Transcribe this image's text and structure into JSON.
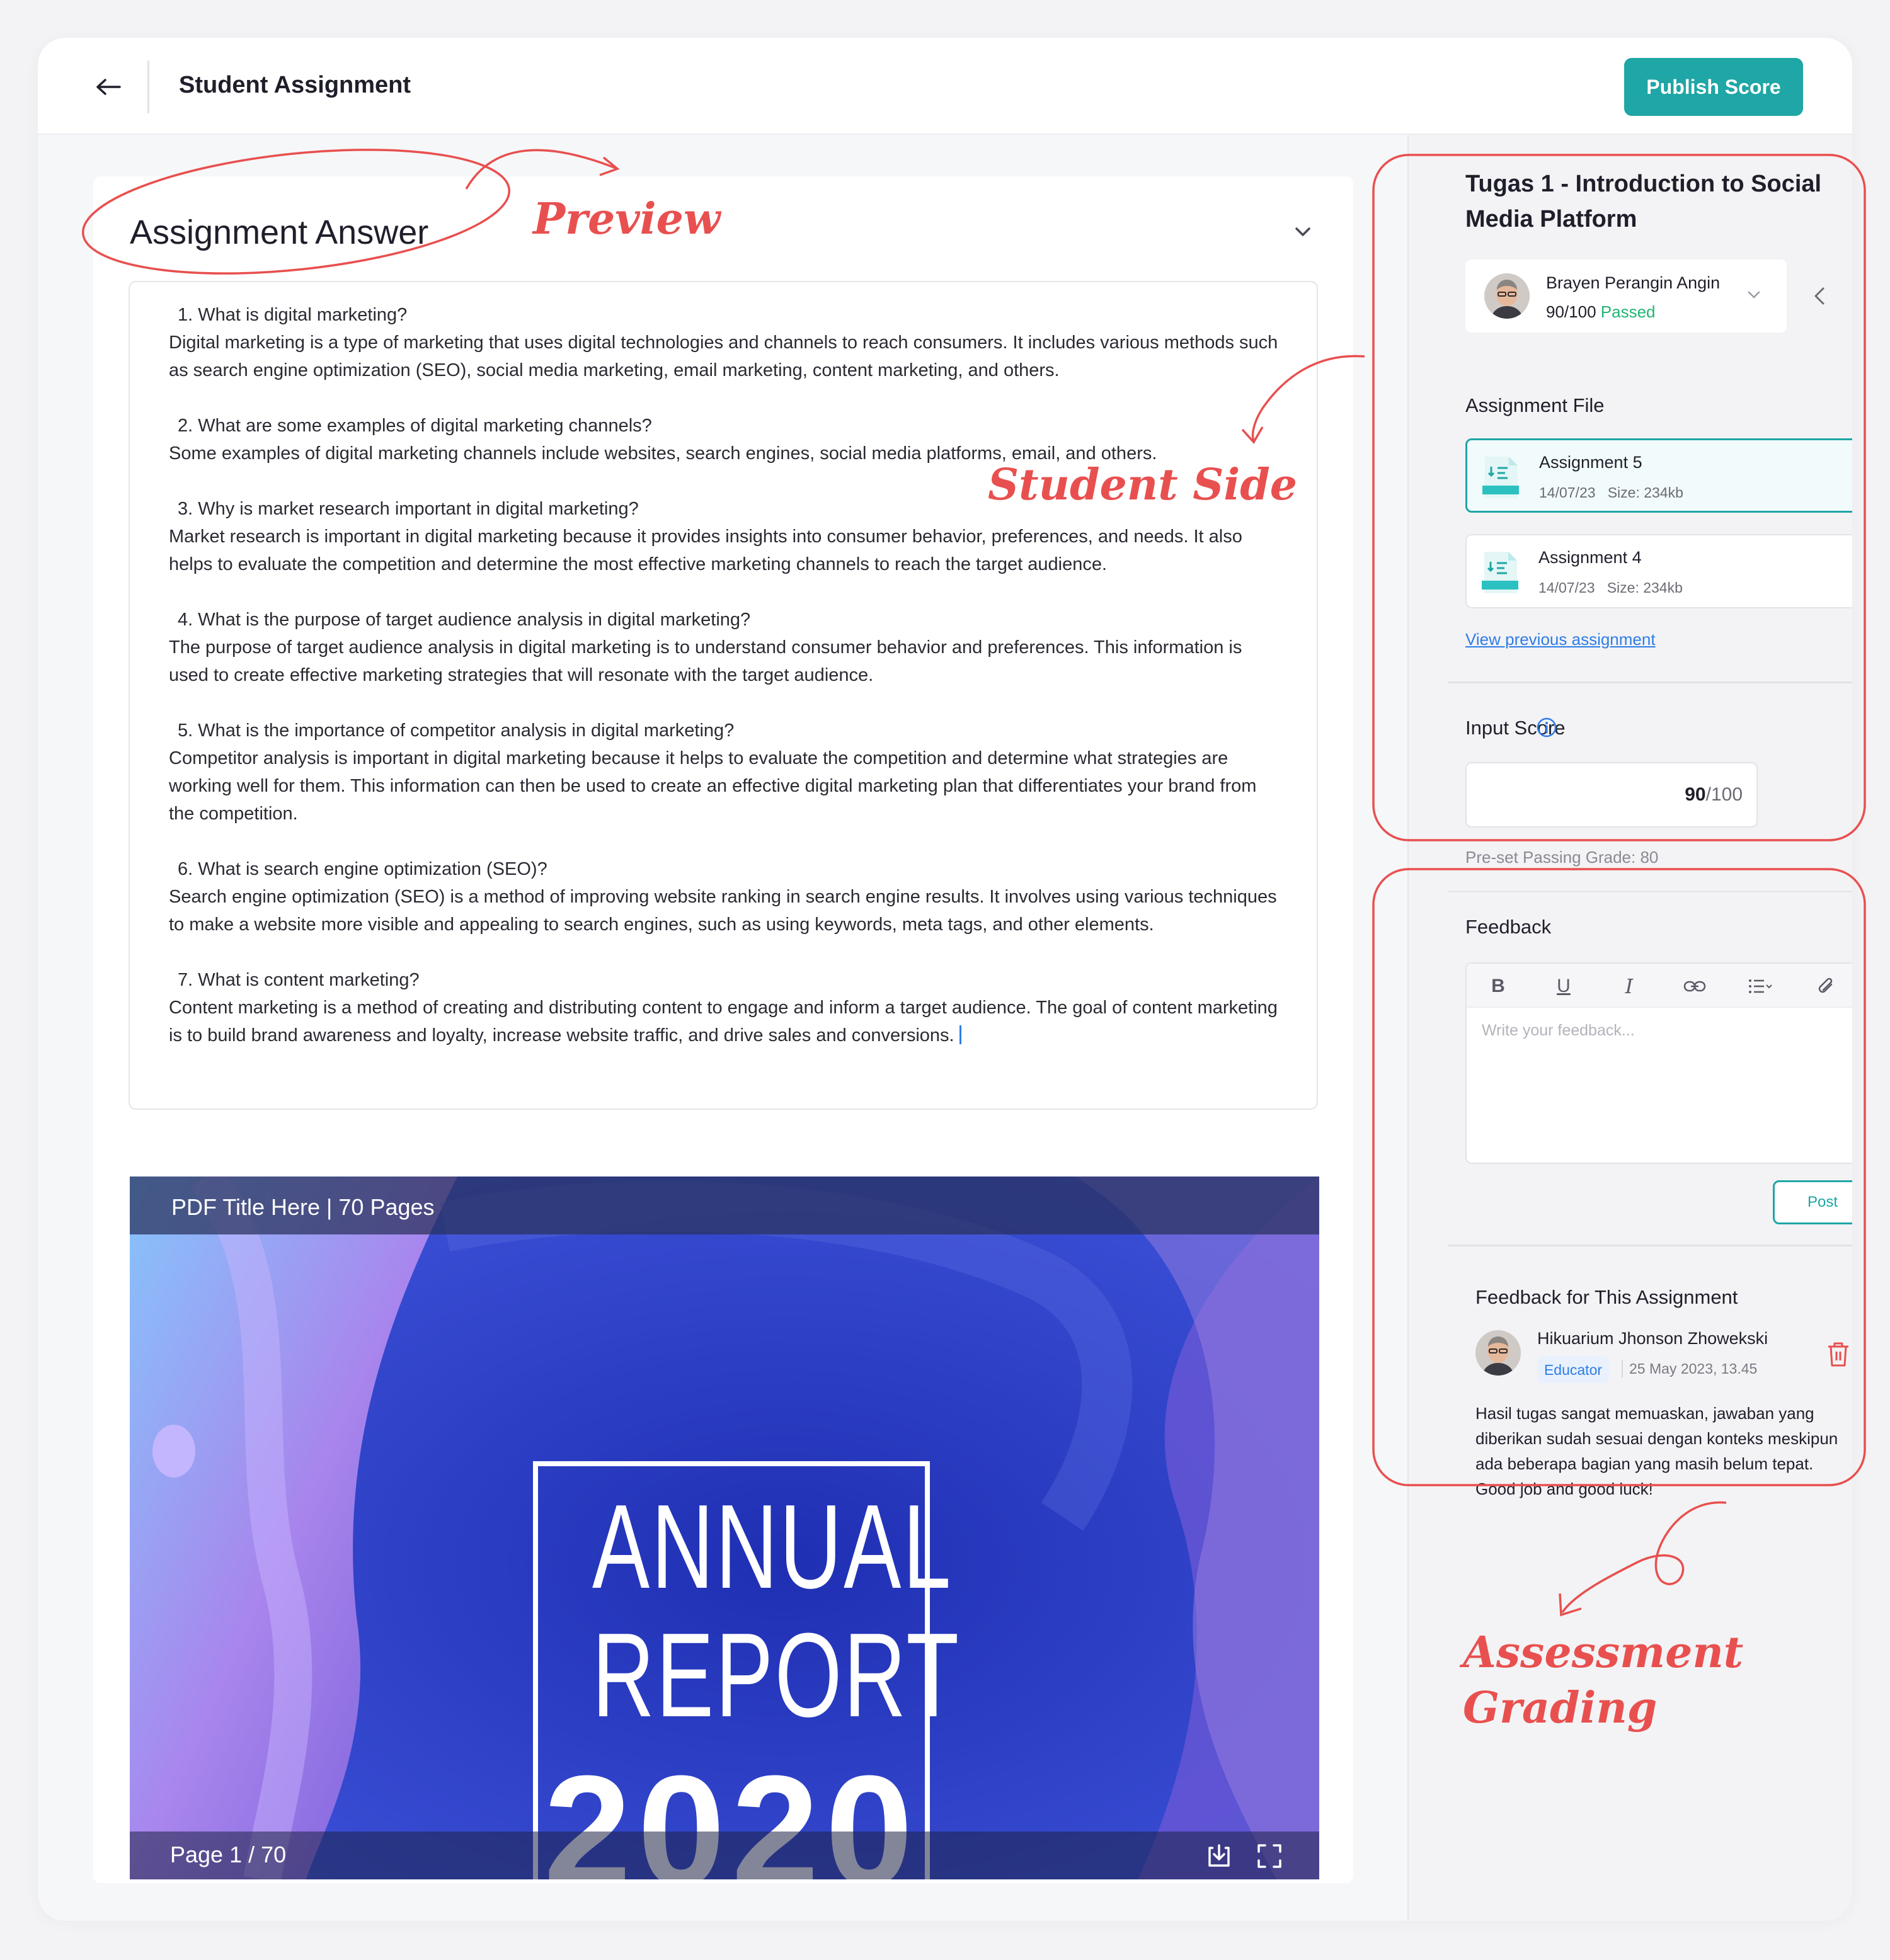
{
  "header": {
    "title": "Student Assignment",
    "publish_label": "Publish Score"
  },
  "answer": {
    "title": "Assignment Answer",
    "items": [
      {
        "q": "1.  What is digital marketing?",
        "a": "Digital marketing is a type of marketing that uses digital technologies and channels to reach consumers. It includes various methods such as search engine optimization (SEO), social media marketing, email marketing, content marketing, and others."
      },
      {
        "q": "2.  What are some examples of digital marketing channels?",
        "a": "Some examples of digital marketing channels include websites, search engines, social media platforms, email, and others."
      },
      {
        "q": "3.  Why is market research important in digital marketing?",
        "a": "Market research is important in digital marketing because it provides insights into consumer behavior, preferences, and needs. It also helps to evaluate the competition and determine the most effective marketing channels to reach the target audience."
      },
      {
        "q": "4.  What is the purpose of target audience analysis in digital marketing?",
        "a": "The purpose of target audience analysis in digital marketing is to understand consumer behavior and preferences. This information is used to create effective marketing strategies that will resonate with the target audience."
      },
      {
        "q": "5.  What is the importance of competitor analysis in digital marketing?",
        "a": "Competitor analysis is important in digital marketing because it helps to evaluate the competition and determine what strategies are working well for them. This information can then be used to create an effective digital marketing plan that differentiates your brand from the competition."
      },
      {
        "q": "6.  What is search engine optimization (SEO)?",
        "a": "Search engine optimization (SEO) is a method of improving website ranking in search engine results. It involves using various techniques to make a website more visible and appealing to search engines, such as using keywords, meta tags, and other elements."
      },
      {
        "q": "7.  What is content marketing?",
        "a": "Content marketing is a method of creating and distributing content to engage and inform a target audience. The goal of content marketing is to build brand awareness and loyalty, increase website traffic, and drive sales and conversions."
      }
    ]
  },
  "pdf": {
    "title": "PDF Title Here | 70 Pages",
    "page": "Page 1 / 70",
    "cover_line1": "ANNUAL",
    "cover_line2": "REPORT",
    "cover_line3": "2020"
  },
  "panel": {
    "assignment_title": "Tugas 1 - Introduction to Social Media Platform",
    "student": {
      "name": "Brayen Perangin Angin",
      "score": "90",
      "score_total": "/100",
      "status": "Passed"
    },
    "file_section_label": "Assignment File",
    "files": [
      {
        "name": "Assignment 5",
        "date": "14/07/23",
        "size": "Size: 234kb"
      },
      {
        "name": "Assignment 4",
        "date": "14/07/23",
        "size": "Size: 234kb"
      }
    ],
    "view_previous": "View previous assignment",
    "input_score_label": "Input Score",
    "score_value": "90",
    "score_total": "/100",
    "passing_grade": "Pre-set Passing Grade: 80",
    "feedback_label": "Feedback",
    "feedback_placeholder": "Write your feedback...",
    "post_label": "Post",
    "feedback_list_title": "Feedback for This Assignment",
    "comment": {
      "author": "Hikuarium Jhonson Zhowekski",
      "role": "Educator",
      "date": "25 May 2023, 13.45",
      "body": "Hasil tugas sangat memuaskan, jawaban yang diberikan sudah sesuai dengan konteks meskipun ada beberapa bagian yang masih belum tepat. Good job and good luck!"
    }
  },
  "annotations": {
    "preview": "Preview",
    "student_side": "Student Side",
    "assessment_line1": "Assessment",
    "assessment_line2": "Grading"
  },
  "colors": {
    "accent": "#1fa6a6",
    "annotation": "#e8504f",
    "passed": "#22b573",
    "link": "#2e7de6"
  }
}
